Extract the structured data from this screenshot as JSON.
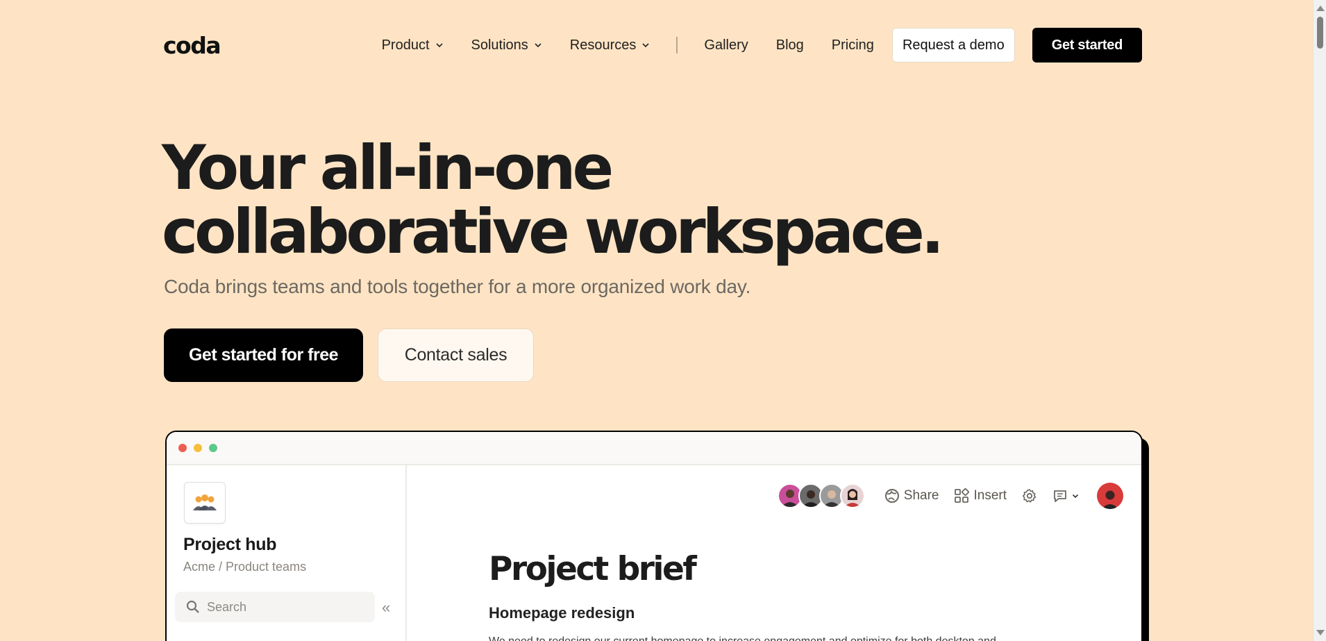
{
  "nav": {
    "logo": "coda",
    "product": "Product",
    "solutions": "Solutions",
    "resources": "Resources",
    "gallery": "Gallery",
    "blog": "Blog",
    "pricing": "Pricing",
    "request_demo": "Request a demo",
    "get_started": "Get started"
  },
  "hero": {
    "title_line1": "Your all-in-one",
    "title_line2": "collaborative workspace.",
    "subtitle": "Coda brings teams and tools together for a more organized work day.",
    "cta_primary": "Get started for free",
    "cta_secondary": "Contact sales"
  },
  "app": {
    "sidebar": {
      "doc_title": "Project hub",
      "path": "Acme / Product teams",
      "search_placeholder": "Search",
      "collapse_glyph": "«"
    },
    "toolbar": {
      "share": "Share",
      "insert": "Insert"
    },
    "doc": {
      "title": "Project brief",
      "heading": "Homepage redesign",
      "paragraph": "We need to redesign our current homepage to increase engagement and optimize for both desktop and"
    }
  },
  "colors": {
    "page_bg": "#fee4c4",
    "primary_button": "#000000",
    "window_border": "#000000"
  }
}
